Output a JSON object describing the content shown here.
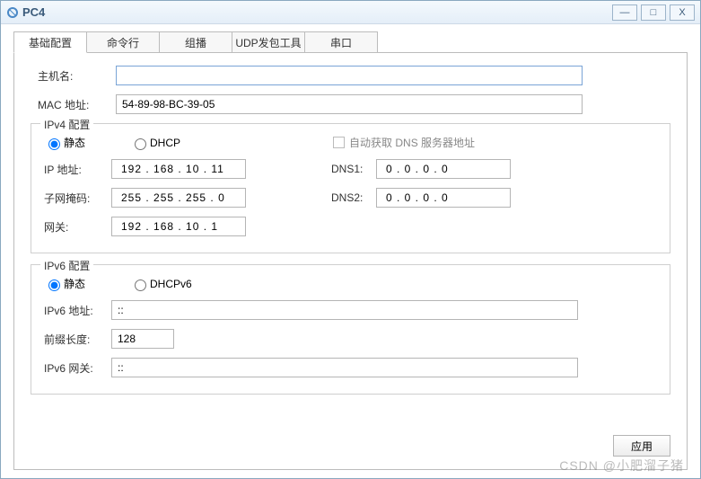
{
  "window": {
    "title": "PC4"
  },
  "titlebar_buttons": {
    "min": "—",
    "max": "□",
    "close": "X"
  },
  "tabs": [
    "基础配置",
    "命令行",
    "组播",
    "UDP发包工具",
    "串口"
  ],
  "labels": {
    "hostname": "主机名:",
    "mac": "MAC 地址:",
    "ipv4_legend": "IPv4 配置",
    "ipv6_legend": "IPv6 配置",
    "static": "静态",
    "dhcp": "DHCP",
    "dhcpv6": "DHCPv6",
    "autodns": "自动获取 DNS 服务器地址",
    "ip": "IP 地址:",
    "mask": "子网掩码:",
    "gw": "网关:",
    "dns1": "DNS1:",
    "dns2": "DNS2:",
    "ipv6_addr": "IPv6 地址:",
    "prefix": "前缀长度:",
    "ipv6_gw": "IPv6 网关:",
    "apply": "应用"
  },
  "values": {
    "hostname": "",
    "mac": "54-89-98-BC-39-05",
    "ip": "192  .  168  .  10  .  11",
    "mask": "255  .  255  .  255  .  0",
    "gw": "192  .  168  .  10  .  1",
    "dns1": "0   .   0   .   0   .   0",
    "dns2": "0   .   0   .   0   .   0",
    "ipv6_addr": "::",
    "prefix": "128",
    "ipv6_gw": "::"
  },
  "watermark": "CSDN @小肥溜子猪"
}
